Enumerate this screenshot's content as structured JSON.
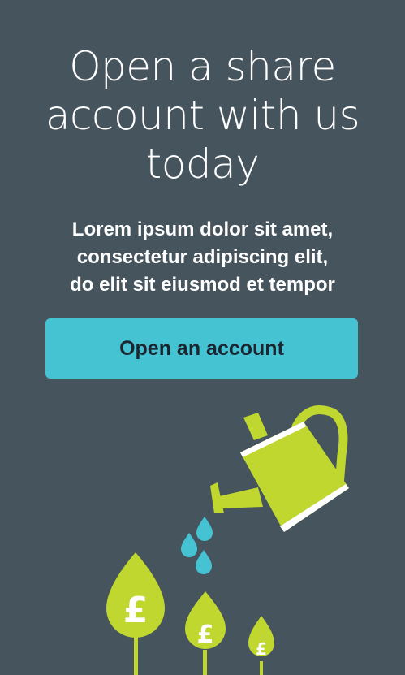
{
  "hero": {
    "title_lines": [
      "Open a share",
      "account with us",
      "today"
    ],
    "subtitle_lines": [
      "Lorem ipsum dolor sit amet,",
      "consectetur adipiscing elit,",
      "do elit sit eiusmod et tempor"
    ]
  },
  "cta": {
    "label": "Open an account"
  },
  "illustration": {
    "icons": [
      "watering-can-icon",
      "water-drop-icon",
      "pound-tree-icon"
    ],
    "currency_symbol": "£",
    "colors": {
      "background": "#46545e",
      "accent_button": "#45c3d3",
      "plant_green": "#bfd72f",
      "water_blue": "#45c3d3"
    }
  }
}
